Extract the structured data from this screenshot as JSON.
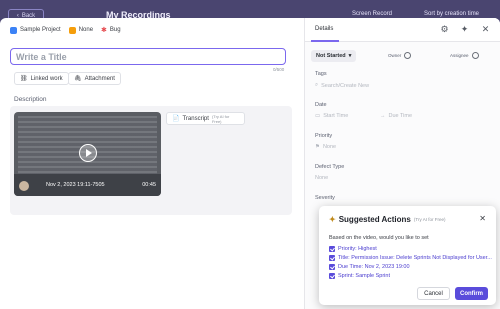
{
  "background": {
    "back_label": "Back",
    "page_title": "My Recordings",
    "screen_record_label": "Screen Record",
    "sort_label": "Sort by creation time"
  },
  "breadcrumb": [
    {
      "label": "Sample Project",
      "color": "#3b82f6"
    },
    {
      "label": "None",
      "color": "#f59e0b"
    },
    {
      "label": "Bug",
      "color": "#e5484d"
    }
  ],
  "title_field": {
    "placeholder": "Write a Title",
    "counter": "0/500"
  },
  "chips": {
    "linked_work": "Linked work",
    "attachment": "Attachment"
  },
  "description": {
    "label": "Description"
  },
  "video": {
    "date": "Nov 2, 2023 19:11-7505",
    "duration": "00:45"
  },
  "transcript": {
    "label": "Transcript",
    "ai_note": "(Try AI for Free)"
  },
  "details_panel": {
    "tab": "Details",
    "status": "Not Started",
    "owner_label": "Owner",
    "assignee_label": "Assignee",
    "fields": {
      "tags_label": "Tags",
      "tags_value": "Search/Create New",
      "date_label": "Date",
      "start_date": "Start Time",
      "due_date": "Due Time",
      "priority_label": "Priority",
      "priority_value": "None",
      "defect_type_label": "Defect Type",
      "defect_type_value": "None",
      "severity_label": "Severity"
    }
  },
  "suggested_actions": {
    "title": "Suggested Actions",
    "ai_note": "(Try AI for Free)",
    "lead": "Based on the video, would you like to set",
    "items": [
      "Priority: Highest",
      "Title: Permission Issue: Delete Sprints Not Displayed for User...",
      "Due Time: Nov 2, 2023 19:00",
      "Sprint: Sample Sprint"
    ],
    "cancel": "Cancel",
    "confirm": "Confirm"
  },
  "colors": {
    "accent": "#7b68ee",
    "confirm": "#5a4cdb"
  }
}
